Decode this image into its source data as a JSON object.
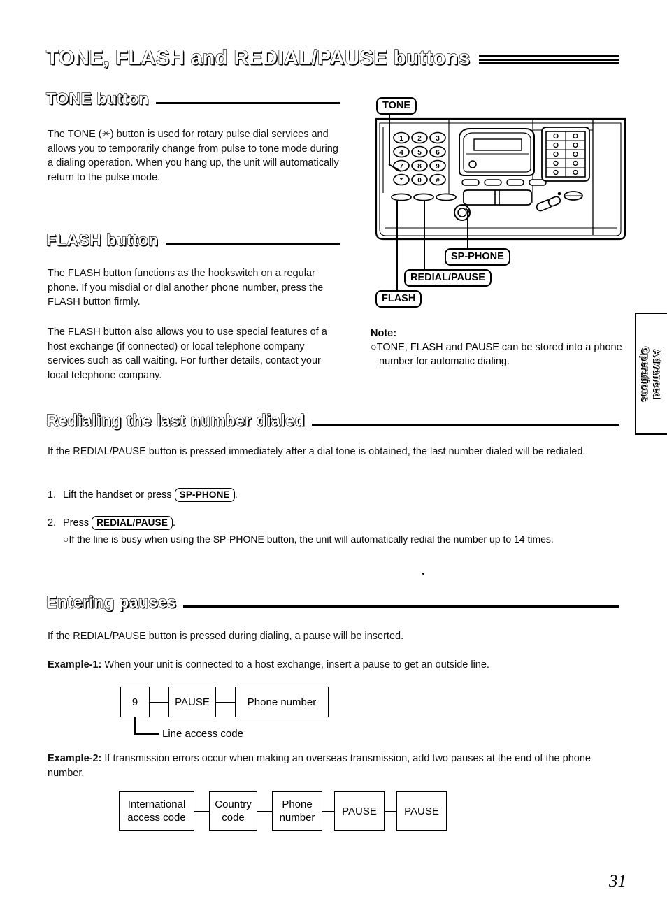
{
  "page": {
    "title": "TONE, FLASH and REDIAL/PAUSE buttons",
    "number": "31"
  },
  "side_tab": {
    "line1": "Advanced",
    "line2": "Operations"
  },
  "sections": {
    "tone": {
      "heading": "TONE button",
      "body": "The TONE (✳) button is used for rotary pulse dial services and allows you to temporarily change from pulse to tone mode during a dialing operation. When you hang up, the unit will automatically return to the pulse mode."
    },
    "flash": {
      "heading": "FLASH button",
      "paragraph1": "The FLASH button functions as the hookswitch on a regular phone. If you misdial or dial another phone number, press the FLASH button firmly.",
      "paragraph2": "The FLASH button also allows you to use special features of a host exchange (if connected) or local telephone company services such as call waiting. For further details, contact your local telephone company."
    },
    "redialing": {
      "heading": "Redialing the last number dialed",
      "intro": "If the REDIAL/PAUSE button is pressed immediately after a dial tone is obtained, the last number dialed will be redialed.",
      "step1_num": "1.",
      "step1_before": "Lift the handset or press",
      "step1_key": "SP-PHONE",
      "step1_after": ".",
      "step2_num": "2.",
      "step2_before": "Press",
      "step2_key": "REDIAL/PAUSE",
      "step2_after": ".",
      "step2_bullet": "○If the line is busy when using the SP-PHONE button, the unit will automatically redial the number up to 14 times."
    },
    "pauses": {
      "heading": "Entering pauses",
      "intro": "If the REDIAL/PAUSE button is pressed during dialing, a pause will be inserted.",
      "example1_label": "Example-1:",
      "example1_text": "When your unit is connected to a host exchange, insert a pause to get an outside line.",
      "example1_boxes": [
        "9",
        "PAUSE",
        "Phone number"
      ],
      "example1_leader_label": "Line access code",
      "example2_label": "Example-2:",
      "example2_text": "If transmission errors occur when making an overseas transmission, add two pauses at the end of the phone number.",
      "example2_boxes": [
        "International access code",
        "Country code",
        "Phone number",
        "PAUSE",
        "PAUSE"
      ]
    }
  },
  "note": {
    "title": "Note:",
    "item": "○TONE, FLASH and PAUSE can be stored into a phone number for automatic dialing."
  },
  "illustration": {
    "alt": "Fax machine control panel line drawing",
    "callouts": {
      "tone": "TONE",
      "sp_phone": "SP-PHONE",
      "redial_pause": "REDIAL/PAUSE",
      "flash": "FLASH"
    },
    "keypad": [
      "1",
      "2",
      "3",
      "4",
      "5",
      "6",
      "7",
      "8",
      "9",
      "✳",
      "0",
      "#"
    ]
  }
}
